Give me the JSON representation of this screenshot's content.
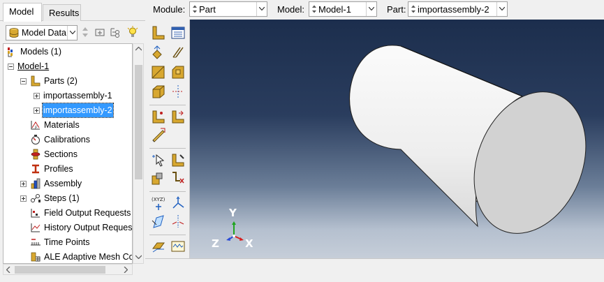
{
  "tabs": [
    {
      "label": "Model",
      "active": true
    },
    {
      "label": "Results",
      "active": false
    }
  ],
  "tree_toolbar": {
    "combo_value": "Model Data",
    "icons": [
      "database-icon",
      "up-down-arrows-icon",
      "filter-icon",
      "expand-tree-icon",
      "lightbulb-icon"
    ]
  },
  "tree": {
    "items": [
      {
        "label": "Models (1)",
        "icon": "models-icon"
      },
      {
        "label": "Model-1",
        "icon": "none"
      },
      {
        "label": "Parts (2)",
        "icon": "parts-icon"
      },
      {
        "label": "importassembly-1",
        "icon": "none"
      },
      {
        "label": "importassembly-2",
        "icon": "none",
        "selected": true
      },
      {
        "label": "Materials",
        "icon": "materials-icon"
      },
      {
        "label": "Calibrations",
        "icon": "calibrations-icon"
      },
      {
        "label": "Sections",
        "icon": "sections-icon"
      },
      {
        "label": "Profiles",
        "icon": "profiles-icon"
      },
      {
        "label": "Assembly",
        "icon": "assembly-icon"
      },
      {
        "label": "Steps (1)",
        "icon": "steps-icon"
      },
      {
        "label": "Field Output Requests",
        "icon": "field-output-icon"
      },
      {
        "label": "History Output Requests",
        "icon": "history-output-icon"
      },
      {
        "label": "Time Points",
        "icon": "time-points-icon"
      },
      {
        "label": "ALE Adaptive Mesh Constraints",
        "icon": "ale-mesh-icon"
      }
    ]
  },
  "context_bar": {
    "module_label": "Module:",
    "module_value": "Part",
    "model_label": "Model:",
    "model_value": "Model-1",
    "part_label": "Part:",
    "part_value": "importassembly-2"
  },
  "viewport": {
    "triad": {
      "y": "Y",
      "z": "Z",
      "x": "X"
    },
    "colors": {
      "bg_top": "#1c2e4d",
      "bg_bottom": "#c6ced9",
      "axis_x": "#d61f1f",
      "axis_y": "#1fa51f",
      "axis_z": "#2a4bd6"
    }
  }
}
